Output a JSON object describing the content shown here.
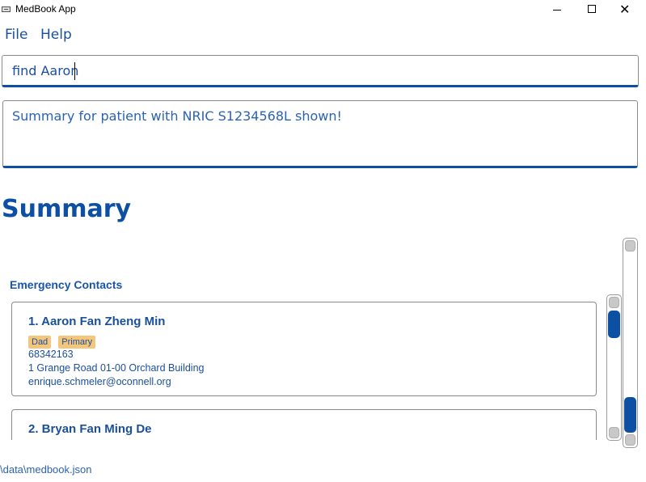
{
  "window": {
    "title": "MedBook App",
    "app_icon": "app-window-icon",
    "controls": {
      "minimize": "minimize-icon",
      "maximize": "maximize-icon",
      "close_glyph": "✕"
    }
  },
  "menu": {
    "file": "File",
    "help": "Help"
  },
  "command": {
    "value": "find Aaron"
  },
  "result": {
    "text": "Summary for patient with NRIC S1234568L shown!"
  },
  "summary": {
    "heading": "Summary",
    "emergency_label": "Emergency Contacts",
    "contacts": [
      {
        "name": "1.  Aaron Fan Zheng Min",
        "tags": [
          "Dad",
          "Primary"
        ],
        "phone": "68342163",
        "address": "1 Grange Road 01-00 Orchard Building",
        "email": "enrique.schmeler@oconnell.org"
      },
      {
        "name": "2.  Bryan Fan Ming De"
      }
    ]
  },
  "status": {
    "path": "\\data\\medbook.json"
  },
  "colors": {
    "accent": "#0d4fa3",
    "text": "#1a4f9c",
    "tag": "#f4c67c"
  }
}
